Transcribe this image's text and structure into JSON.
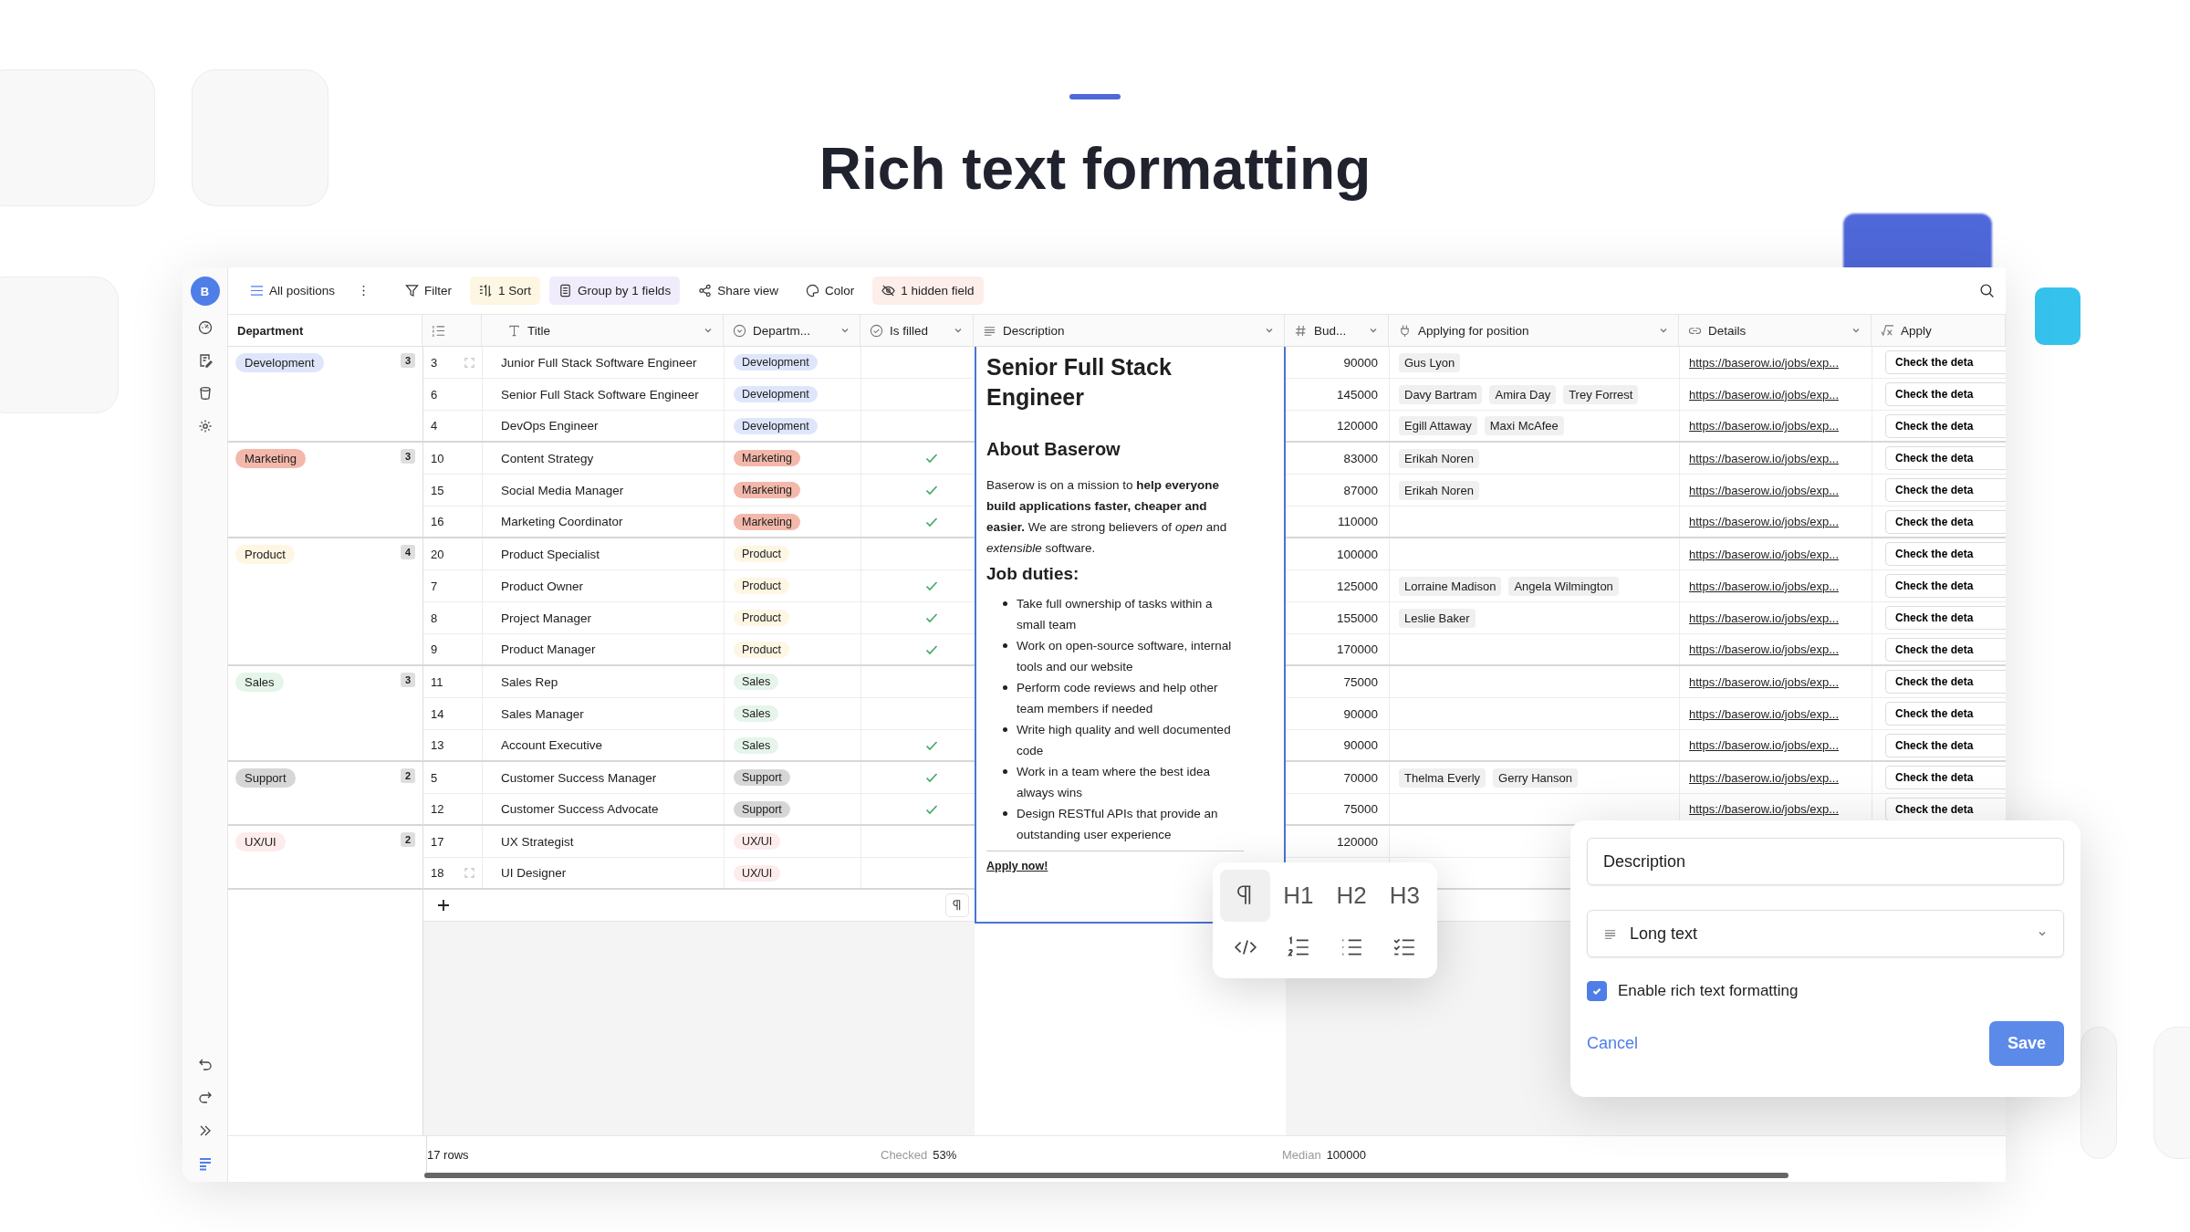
{
  "page_title": "Rich text formatting",
  "avatar": "B",
  "toolbar": {
    "view": "All positions",
    "items": [
      {
        "label": "Filter",
        "kind": "filter",
        "active": false
      },
      {
        "label": "1 Sort",
        "kind": "sort",
        "active": true
      },
      {
        "label": "Group by 1 fields",
        "kind": "group",
        "active": true
      },
      {
        "label": "Share view",
        "kind": "share",
        "active": false
      },
      {
        "label": "Color",
        "kind": "color",
        "active": false
      },
      {
        "label": "1 hidden field",
        "kind": "hidden",
        "active": true
      }
    ]
  },
  "columns": [
    {
      "label": "Department",
      "kind": "group"
    },
    {
      "label": "Title",
      "kind": "text"
    },
    {
      "label": "Departm...",
      "kind": "select"
    },
    {
      "label": "Is filled",
      "kind": "boolean"
    },
    {
      "label": "Description",
      "kind": "longtext"
    },
    {
      "label": "Bud...",
      "kind": "number"
    },
    {
      "label": "Applying for position",
      "kind": "linkrow"
    },
    {
      "label": "Details",
      "kind": "url"
    },
    {
      "label": "Apply",
      "kind": "formula"
    }
  ],
  "groups": [
    {
      "name": "Development",
      "count": "3",
      "color": "#dfe6fb",
      "rows": [
        {
          "id": "3",
          "expand_handle": true,
          "title": "Junior Full Stack Software Engineer",
          "department": "Development",
          "filled": false,
          "budget": "90000",
          "applicants": [
            "Gus Lyon"
          ],
          "details": "https://baserow.io/jobs/exp...",
          "apply": "Check the deta"
        },
        {
          "id": "6",
          "expand_handle": false,
          "title": "Senior Full Stack Software Engineer",
          "department": "Development",
          "filled": false,
          "budget": "145000",
          "applicants": [
            "Davy Bartram",
            "Amira Day",
            "Trey Forrest"
          ],
          "details": "https://baserow.io/jobs/exp...",
          "apply": "Check the deta"
        },
        {
          "id": "4",
          "expand_handle": false,
          "title": "DevOps Engineer",
          "department": "Development",
          "filled": false,
          "budget": "120000",
          "applicants": [
            "Egill Attaway",
            "Maxi McAfee"
          ],
          "details": "https://baserow.io/jobs/exp...",
          "apply": "Check the deta"
        }
      ]
    },
    {
      "name": "Marketing",
      "count": "3",
      "color": "#f3b8ab",
      "rows": [
        {
          "id": "10",
          "expand_handle": false,
          "title": "Content Strategy",
          "department": "Marketing",
          "filled": true,
          "budget": "83000",
          "applicants": [
            "Erikah Noren"
          ],
          "details": "https://baserow.io/jobs/exp...",
          "apply": "Check the deta"
        },
        {
          "id": "15",
          "expand_handle": false,
          "title": "Social Media Manager",
          "department": "Marketing",
          "filled": true,
          "budget": "87000",
          "applicants": [
            "Erikah Noren"
          ],
          "details": "https://baserow.io/jobs/exp...",
          "apply": "Check the deta"
        },
        {
          "id": "16",
          "expand_handle": false,
          "title": "Marketing Coordinator",
          "department": "Marketing",
          "filled": true,
          "budget": "110000",
          "applicants": [],
          "details": "https://baserow.io/jobs/exp...",
          "apply": "Check the deta"
        }
      ]
    },
    {
      "name": "Product",
      "count": "4",
      "color": "#fdf6e3",
      "rows": [
        {
          "id": "20",
          "expand_handle": false,
          "title": "Product Specialist",
          "department": "Product",
          "filled": false,
          "budget": "100000",
          "applicants": [],
          "details": "https://baserow.io/jobs/exp...",
          "apply": "Check the deta"
        },
        {
          "id": "7",
          "expand_handle": false,
          "title": "Product Owner",
          "department": "Product",
          "filled": true,
          "budget": "125000",
          "applicants": [
            "Lorraine Madison",
            "Angela Wilmington"
          ],
          "details": "https://baserow.io/jobs/exp...",
          "apply": "Check the deta"
        },
        {
          "id": "8",
          "expand_handle": false,
          "title": "Project Manager",
          "department": "Product",
          "filled": true,
          "budget": "155000",
          "applicants": [
            "Leslie Baker"
          ],
          "details": "https://baserow.io/jobs/exp...",
          "apply": "Check the deta"
        },
        {
          "id": "9",
          "expand_handle": false,
          "title": "Product Manager",
          "department": "Product",
          "filled": true,
          "budget": "170000",
          "applicants": [],
          "details": "https://baserow.io/jobs/exp...",
          "apply": "Check the deta"
        }
      ]
    },
    {
      "name": "Sales",
      "count": "3",
      "color": "#e5f5e9",
      "rows": [
        {
          "id": "11",
          "expand_handle": false,
          "title": "Sales Rep",
          "department": "Sales",
          "filled": false,
          "budget": "75000",
          "applicants": [],
          "details": "https://baserow.io/jobs/exp...",
          "apply": "Check the deta"
        },
        {
          "id": "14",
          "expand_handle": false,
          "title": "Sales Manager",
          "department": "Sales",
          "filled": false,
          "budget": "90000",
          "applicants": [],
          "details": "https://baserow.io/jobs/exp...",
          "apply": "Check the deta"
        },
        {
          "id": "13",
          "expand_handle": false,
          "title": "Account Executive",
          "department": "Sales",
          "filled": true,
          "budget": "90000",
          "applicants": [],
          "details": "https://baserow.io/jobs/exp...",
          "apply": "Check the deta"
        }
      ]
    },
    {
      "name": "Support",
      "count": "2",
      "color": "#d6d6d6",
      "rows": [
        {
          "id": "5",
          "expand_handle": false,
          "title": "Customer Success Manager",
          "department": "Support",
          "filled": true,
          "budget": "70000",
          "applicants": [
            "Thelma Everly",
            "Gerry Hanson"
          ],
          "details": "https://baserow.io/jobs/exp...",
          "apply": "Check the deta"
        },
        {
          "id": "12",
          "expand_handle": false,
          "title": "Customer Success Advocate",
          "department": "Support",
          "filled": true,
          "budget": "75000",
          "applicants": [],
          "details": "https://baserow.io/jobs/exp...",
          "apply": "Check the deta"
        }
      ]
    },
    {
      "name": "UX/UI",
      "count": "2",
      "color": "#fdeceb",
      "rows": [
        {
          "id": "17",
          "expand_handle": false,
          "title": "UX Strategist",
          "department": "UX/UI",
          "filled": false,
          "budget": "120000",
          "applicants": []
        },
        {
          "id": "18",
          "expand_handle": true,
          "title": "UI Designer",
          "department": "UX/UI",
          "filled": false,
          "applicants": []
        }
      ]
    }
  ],
  "editor": {
    "heading": "Senior Full Stack Engineer",
    "subheading": "About Baserow",
    "paragraph": "Baserow is on a mission to **help everyone build applications faster, cheaper and easier.** We are strong believers of *open* and *extensible* software.",
    "list_heading": "Job duties:",
    "bullets": [
      "Take full ownership of tasks within a small team",
      "Work on open-source software, internal tools and our website",
      "Perform code reviews and help other team members if needed",
      "Write high quality and well documented code",
      "Work in a team where the best idea always wins",
      "Design RESTful APIs that provide an outstanding user experience"
    ],
    "link": "Apply now!"
  },
  "format_toolbar": [
    {
      "kind": "paragraph",
      "selected": true
    },
    {
      "kind": "heading",
      "label": "H1",
      "selected": false
    },
    {
      "kind": "heading",
      "label": "H2",
      "selected": false
    },
    {
      "kind": "heading",
      "label": "H3",
      "selected": false
    },
    {
      "kind": "code",
      "selected": false
    },
    {
      "kind": "ordered",
      "selected": false
    },
    {
      "kind": "bullet",
      "selected": false
    },
    {
      "kind": "task",
      "selected": false
    }
  ],
  "footer": {
    "rows": "17 rows",
    "checked_label": "Checked",
    "checked_value": "53%",
    "median_label": "Median",
    "median_value": "100000"
  },
  "field_dialog": {
    "name": "Description",
    "type": "Long text",
    "rich_text": true,
    "rich_text_label": "Enable rich text formatting",
    "cancel": "Cancel",
    "save": "Save"
  }
}
